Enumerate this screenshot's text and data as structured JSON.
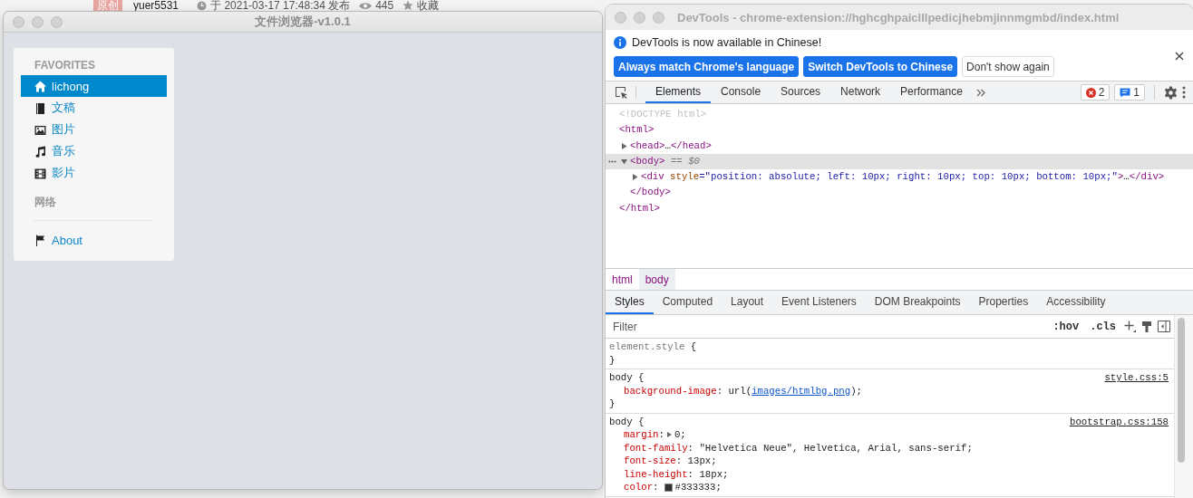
{
  "background_page": {
    "badge": "原创",
    "author": "yuer5531",
    "published": "于 2021-03-17 17:48:34 发布",
    "views": "445",
    "favorite": "收藏"
  },
  "app_window": {
    "title": "文件浏览器-v1.0.1",
    "sidebar": {
      "groups": [
        {
          "heading": "FAVORITES",
          "items": [
            {
              "label": "lichong",
              "kind": "home",
              "selected": true
            },
            {
              "label": "文稿",
              "kind": "book",
              "selected": false
            },
            {
              "label": "图片",
              "kind": "picture",
              "selected": false
            },
            {
              "label": "音乐",
              "kind": "music",
              "selected": false
            },
            {
              "label": "影片",
              "kind": "film",
              "selected": false
            }
          ]
        },
        {
          "heading": "网络"
        },
        {
          "items": [
            {
              "label": "About",
              "kind": "flag",
              "selected": false
            }
          ]
        }
      ]
    }
  },
  "devtools": {
    "title": "DevTools - chrome-extension://hghcghpaiclllpedicjhebmjinnmgmbd/index.html",
    "infobar": {
      "message": "DevTools is now available in Chinese!",
      "buttons": [
        {
          "label": "Always match Chrome's language",
          "primary": true
        },
        {
          "label": "Switch DevTools to Chinese",
          "primary": true
        },
        {
          "label": "Don't show again",
          "primary": false
        }
      ]
    },
    "tabs": [
      {
        "label": "Elements",
        "selected": true
      },
      {
        "label": "Console",
        "selected": false
      },
      {
        "label": "Sources",
        "selected": false
      },
      {
        "label": "Network",
        "selected": false
      },
      {
        "label": "Performance",
        "selected": false
      }
    ],
    "error_count": "2",
    "message_count": "1",
    "dom_tree": [
      {
        "parts": [
          {
            "kind": "doctype",
            "text": "<!DOCTYPE html>"
          }
        ]
      },
      {
        "parts": [
          {
            "kind": "tag",
            "text": "<html>"
          }
        ],
        "close": "</html>",
        "selected": false,
        "children": [
          {
            "parts": [
              {
                "kind": "tag",
                "text": "<head>"
              }
            ],
            "expanded": false,
            "ellipsis": "…",
            "close": "</head>",
            "selected": false
          },
          {
            "parts": [
              {
                "kind": "tag",
                "text": "<body>"
              },
              {
                "kind": "hint",
                "text": "=="
              },
              {
                "kind": "var",
                "text": "$0"
              }
            ],
            "expanded": true,
            "close": "</body>",
            "selected": true,
            "children": [
              {
                "parts": [
                  {
                    "kind": "tag",
                    "text": "<div"
                  },
                  {
                    "kind": "attr",
                    "text": "style"
                  },
                  {
                    "kind": "value",
                    "text": "=\"position: absolute; left: 10px; right: 10px; top: 10px; bottom: 10px;\""
                  },
                  {
                    "kind": "tag",
                    "text": ">"
                  }
                ],
                "expanded": false,
                "ellipsis": "…",
                "close": "</div>",
                "selected": false
              }
            ]
          }
        ]
      }
    ],
    "breadcrumbs": [
      {
        "label": "html",
        "selected": false
      },
      {
        "label": "body",
        "selected": true
      }
    ],
    "style_tabs": [
      {
        "label": "Styles",
        "selected": true
      },
      {
        "label": "Computed",
        "selected": false
      },
      {
        "label": "Layout",
        "selected": false
      },
      {
        "label": "Event Listeners",
        "selected": false
      },
      {
        "label": "DOM Breakpoints",
        "selected": false
      },
      {
        "label": "Properties",
        "selected": false
      },
      {
        "label": "Accessibility",
        "selected": false
      }
    ],
    "filter": {
      "placeholder": "Filter"
    },
    "filter_buttons": [
      ":hov",
      ".cls"
    ],
    "rules": [
      {
        "selector": "element.style",
        "inline": true,
        "open": "{",
        "end": "}"
      },
      {
        "selector": "body",
        "inline": false,
        "open": "{",
        "end": "}",
        "source": "style.css:5",
        "declarations": [
          {
            "property": "background-image",
            "value": [
              {
                "kind": "text",
                "text": ": url("
              },
              {
                "kind": "link",
                "text": "images/htmlbg.png"
              },
              {
                "kind": "text",
                "text": ");"
              }
            ]
          }
        ]
      },
      {
        "selector": "body",
        "inline": false,
        "open": "{",
        "source": "bootstrap.css:158",
        "declarations": [
          {
            "property": "margin",
            "value": [
              {
                "kind": "text",
                "text": ":"
              },
              {
                "kind": "toggle"
              },
              {
                "kind": "text",
                "text": "0;"
              }
            ]
          },
          {
            "property": "font-family",
            "value": [
              {
                "kind": "text",
                "text": ": \"Helvetica Neue\", Helvetica, Arial, sans-serif;"
              }
            ]
          },
          {
            "property": "font-size",
            "value": [
              {
                "kind": "text",
                "text": ": 13px;"
              }
            ]
          },
          {
            "property": "line-height",
            "value": [
              {
                "kind": "text",
                "text": ": 18px;"
              }
            ]
          },
          {
            "property": "color",
            "value": [
              {
                "kind": "text",
                "text": ":"
              },
              {
                "kind": "swatch",
                "color": "#333333"
              },
              {
                "kind": "text",
                "text": "#333333;"
              }
            ]
          }
        ]
      }
    ]
  }
}
